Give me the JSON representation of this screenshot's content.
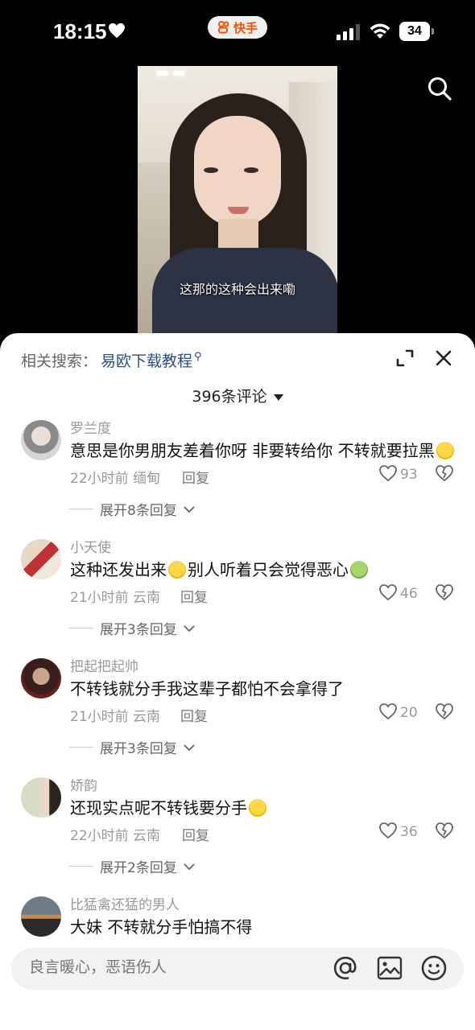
{
  "status_bar": {
    "time": "18:15",
    "app_badge": "快手",
    "battery": "34"
  },
  "video": {
    "caption": "这那的这种会出来嘞"
  },
  "sheet": {
    "related_label": "相关搜索：",
    "related_query": "易欧下载教程",
    "comment_count": "396条评论"
  },
  "comments": [
    {
      "name": "罗兰度",
      "text": "意思是你男朋友差着你呀 非要转给你 不转就要拉黑",
      "emoji": "laughing-tears-emoji",
      "meta": "22小时前 缅甸",
      "reply": "回复",
      "likes": "93",
      "expand": "展开8条回复"
    },
    {
      "name": "小天使",
      "text_part1": "这种还发出来",
      "text_part2": "别人听着只会觉得恶心",
      "emoji1": "laughing-tears-emoji",
      "emoji2": "nauseated-face-emoji",
      "meta": "21小时前 云南",
      "reply": "回复",
      "likes": "46",
      "expand": "展开3条回复"
    },
    {
      "name": "把起把起帅",
      "text": "不转钱就分手我这辈子都怕不会拿得了",
      "meta": "21小时前 云南",
      "reply": "回复",
      "likes": "20",
      "expand": "展开3条回复"
    },
    {
      "name": "娇韵",
      "text": "还现实点呢不转钱要分手",
      "emoji": "laughing-tears-emoji",
      "meta": "22小时前 云南",
      "reply": "回复",
      "likes": "36",
      "expand": "展开2条回复"
    },
    {
      "name": "比猛禽还猛的男人",
      "text": "大妹 不转就分手怕搞不得"
    }
  ],
  "input": {
    "placeholder": "良言暖心，恶语伤人"
  },
  "colors": {
    "link": "#2b4f84",
    "brand": "#ff5000"
  }
}
